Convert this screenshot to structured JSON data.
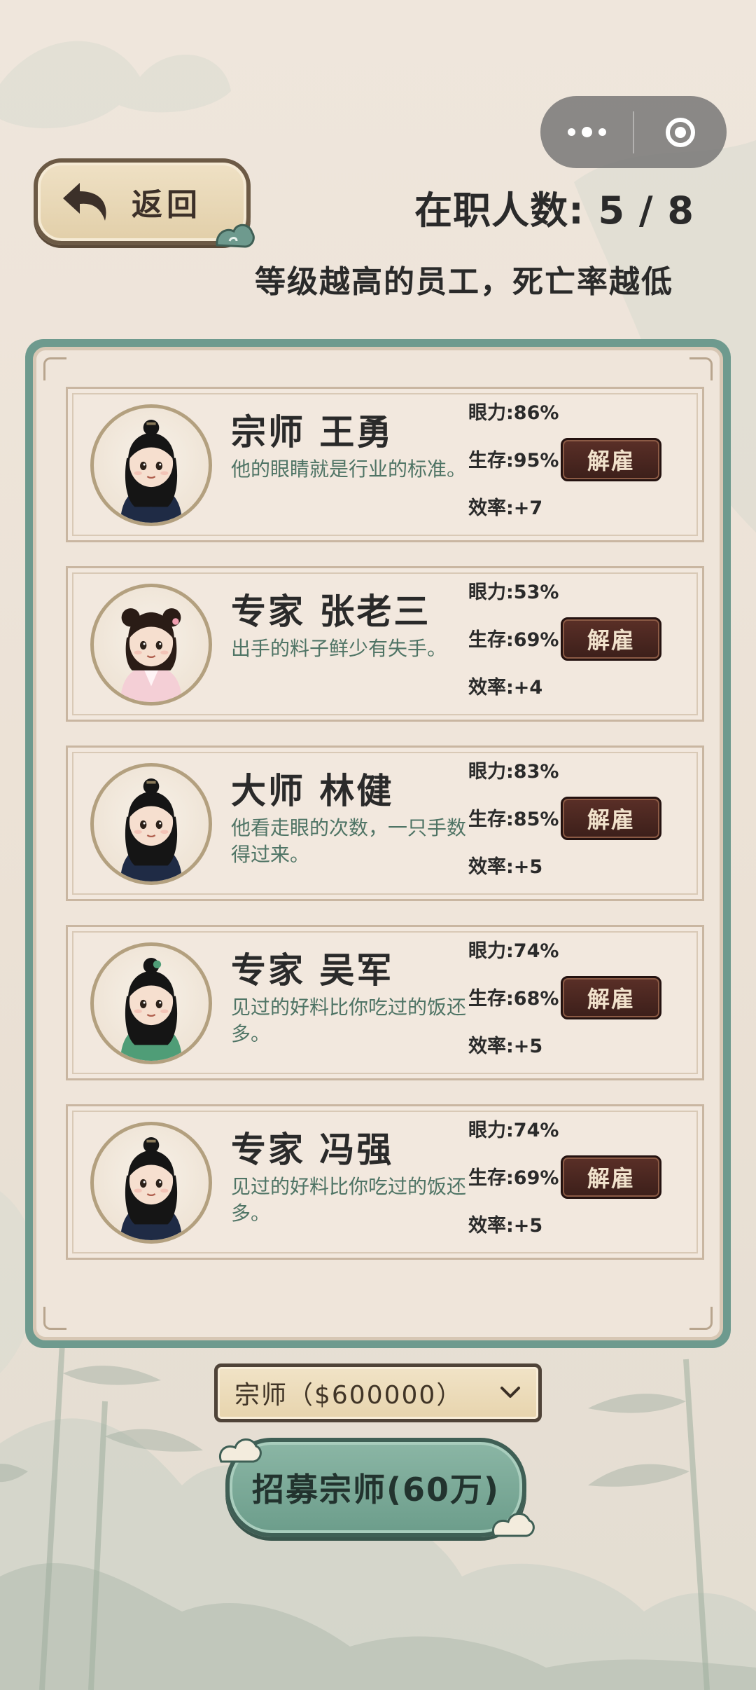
{
  "header": {
    "back_label": "返回",
    "headcount_label": "在职人数:",
    "headcount_current": "5",
    "headcount_max": "8",
    "headcount_text": "在职人数: 5 / 8",
    "tip": "等级越高的员工，死亡率越低"
  },
  "employees": [
    {
      "name": "宗师 王勇",
      "desc": "他的眼睛就是行业的标准。",
      "eyesight": "眼力:86%",
      "survival": "生存:95%",
      "efficiency": "效率:+7",
      "fire_label": "解雇",
      "avatar": "male-dark-robe"
    },
    {
      "name": "专家 张老三",
      "desc": "出手的料子鲜少有失手。",
      "eyesight": "眼力:53%",
      "survival": "生存:69%",
      "efficiency": "效率:+4",
      "fire_label": "解雇",
      "avatar": "female-pink-robe"
    },
    {
      "name": "大师 林健",
      "desc": "他看走眼的次数，一只手数得过来。",
      "eyesight": "眼力:83%",
      "survival": "生存:85%",
      "efficiency": "效率:+5",
      "fire_label": "解雇",
      "avatar": "male-dark-robe"
    },
    {
      "name": "专家 吴军",
      "desc": "见过的好料比你吃过的饭还多。",
      "eyesight": "眼力:74%",
      "survival": "生存:68%",
      "efficiency": "效率:+5",
      "fire_label": "解雇",
      "avatar": "male-green-robe"
    },
    {
      "name": "专家 冯强",
      "desc": "见过的好料比你吃过的饭还多。",
      "eyesight": "眼力:74%",
      "survival": "生存:69%",
      "efficiency": "效率:+5",
      "fire_label": "解雇",
      "avatar": "male-dark-robe"
    }
  ],
  "recruit": {
    "rank_select_value": "宗师（$600000）",
    "button_label": "招募宗师(60万)"
  },
  "colors": {
    "panel_border": "#6e9a8e",
    "fire_button": "#4a261f",
    "recruit_button": "#7aa996"
  }
}
